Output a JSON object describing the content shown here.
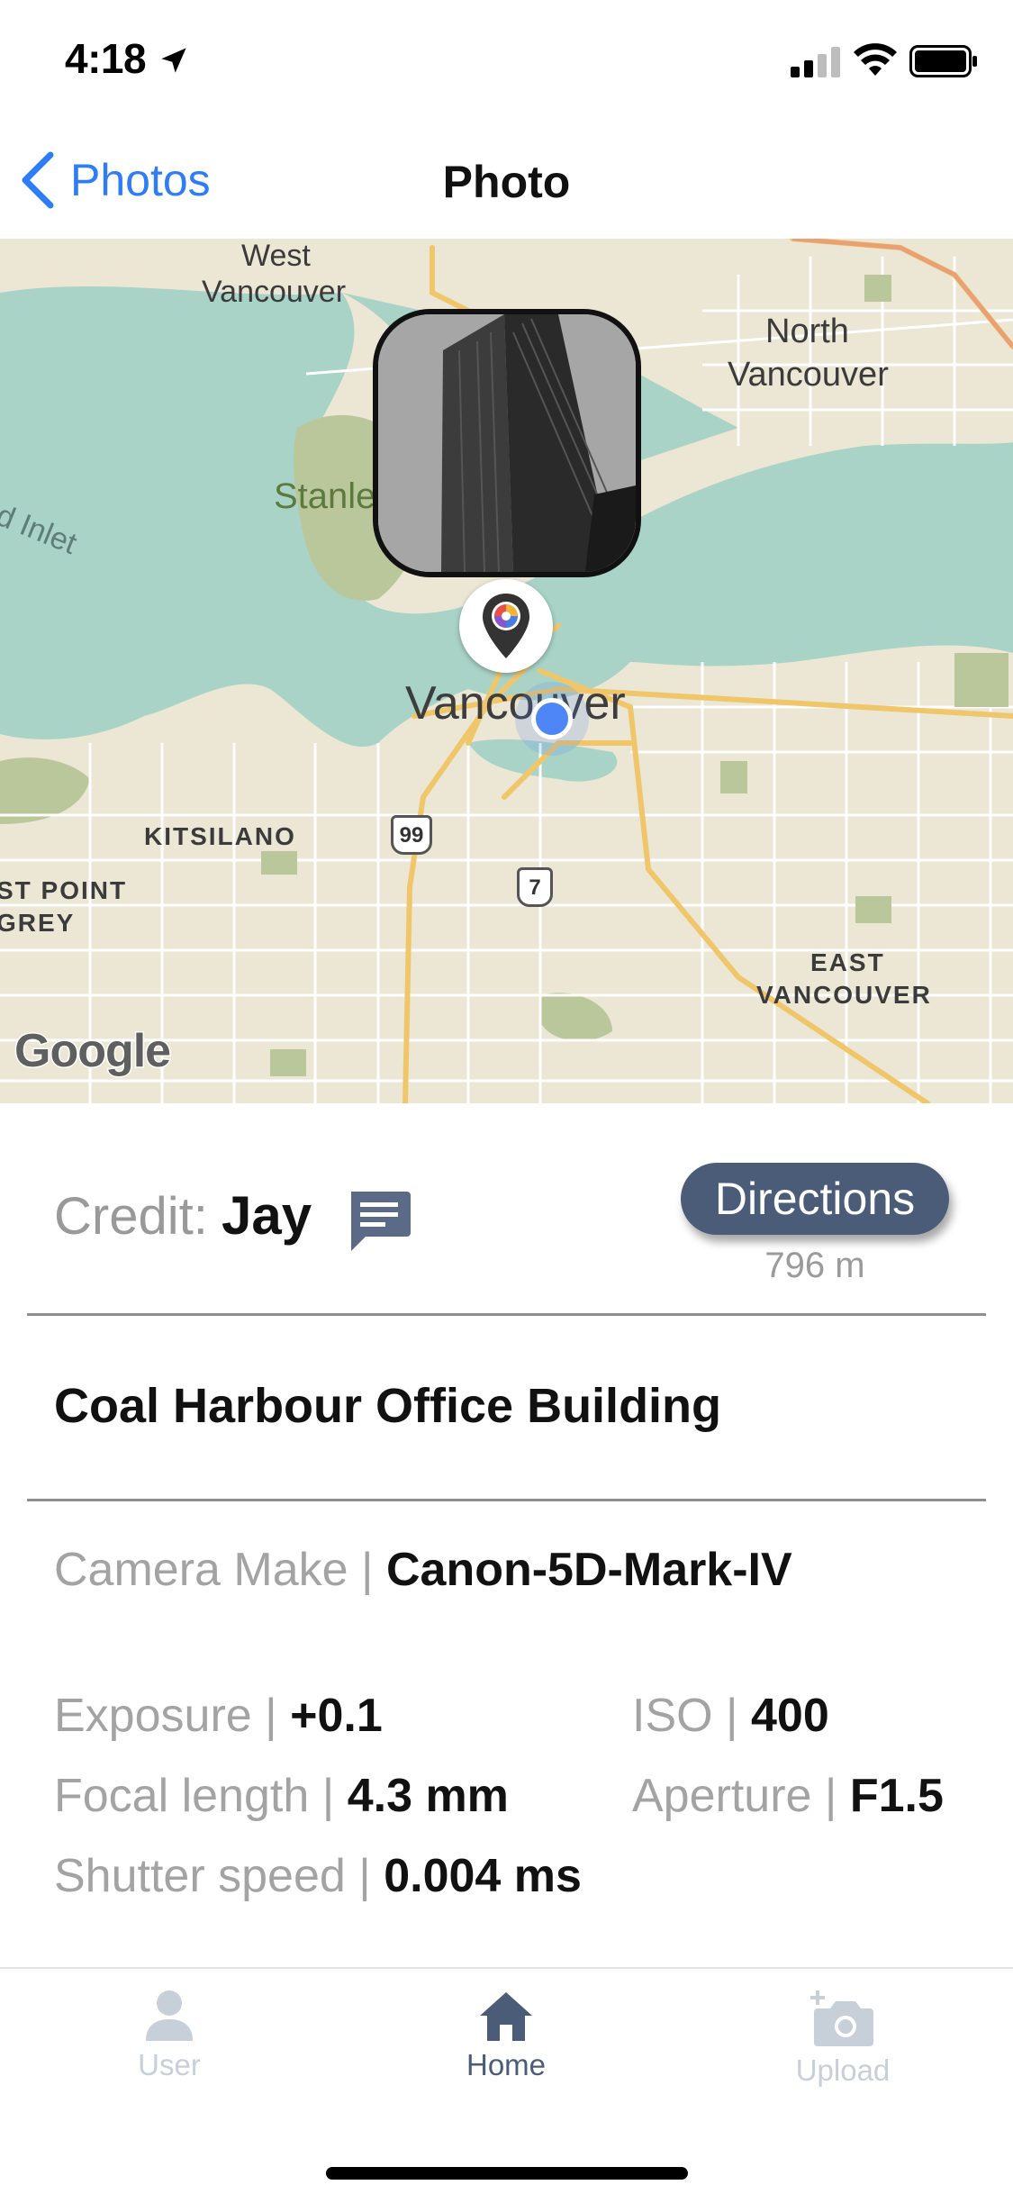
{
  "status_bar": {
    "time": "4:18"
  },
  "nav": {
    "back_label": "Photos",
    "title": "Photo"
  },
  "map": {
    "labels": {
      "west_vancouver_1": "West",
      "west_vancouver_2": "Vancouver",
      "north_vancouver_1": "North",
      "north_vancouver_2": "Vancouver",
      "stanley": "Stanle",
      "inlet": "d Inlet",
      "vancouver": "Vancouver",
      "kitsilano": "KITSILANO",
      "point_grey_1": "ST POINT",
      "point_grey_2": "GREY",
      "east_vancouver_1": "EAST",
      "east_vancouver_2": "VANCOUVER",
      "route_99": "99",
      "route_7": "7"
    },
    "attribution": "Google"
  },
  "details": {
    "credit_label": "Credit:",
    "credit_name": "Jay",
    "directions_label": "Directions",
    "distance": "796 m",
    "place_name": "Coal Harbour Office Building",
    "camera_make_label": "Camera Make |",
    "camera_make_value": "Canon-5D-Mark-IV",
    "exposure_label": "Exposure |",
    "exposure_value": "+0.1",
    "iso_label": "ISO |",
    "iso_value": "400",
    "focal_length_label": "Focal length |",
    "focal_length_value": "4.3 mm",
    "aperture_label": "Aperture |",
    "aperture_value": "F1.5",
    "shutter_speed_label": "Shutter speed |",
    "shutter_speed_value": "0.004 ms"
  },
  "tabs": [
    {
      "label": "User",
      "icon": "user-icon",
      "active": false
    },
    {
      "label": "Home",
      "icon": "home-icon",
      "active": true
    },
    {
      "label": "Upload",
      "icon": "camera-icon",
      "active": false
    }
  ],
  "colors": {
    "accent": "#2e7cf6",
    "directions_button": "#4b5c78",
    "tab_active": "#4b5c78",
    "tab_inactive": "#c7cfd8",
    "water": "#a9d3c7",
    "land": "#ece6d4",
    "park": "#b9c79b"
  }
}
